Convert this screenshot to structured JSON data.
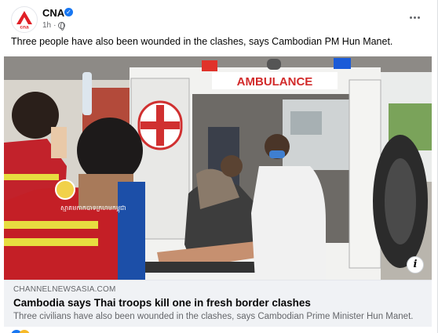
{
  "post": {
    "page_name": "CNA",
    "logo_text": "cna",
    "timestamp": "1h",
    "separator": "·",
    "caption": "Three people have also been wounded in the clashes, says Cambodian PM Hun Manet."
  },
  "image": {
    "ambulance_text": "AMBULANCE",
    "vest_text": "ស្មាគមកាកបាទក្រហមកម្ពុជា"
  },
  "link_preview": {
    "domain": "CHANNELNEWSASIA.COM",
    "title": "Cambodia says Thai troops kill one in fresh border clashes",
    "description": "Three civilians have also been wounded in the clashes, says Cambodian Prime Minister Hun Manet."
  },
  "colors": {
    "brand_red": "#e01f26",
    "verified_blue": "#1877f2",
    "meta_gray": "#65676b"
  },
  "icons": {
    "verified": "verified-badge-icon",
    "audience": "globe-icon",
    "more": "more-options-icon",
    "info": "info-icon"
  }
}
